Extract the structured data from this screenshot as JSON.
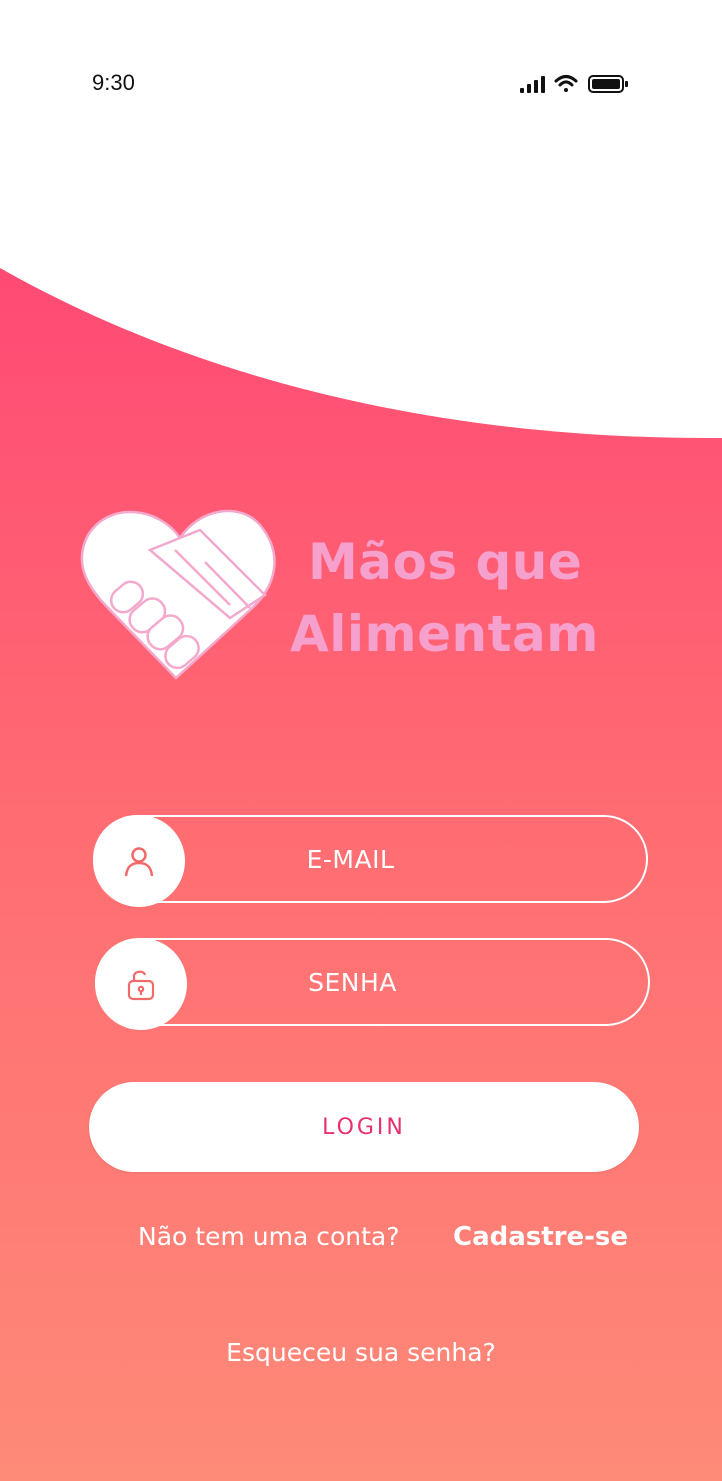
{
  "status_bar": {
    "time": "9:30",
    "icons": [
      "cellular-signal-icon",
      "wifi-icon",
      "battery-icon"
    ]
  },
  "logo": {
    "icon": "heart-handshake-icon",
    "line1": "Mãos que",
    "line2": "Alimentam"
  },
  "form": {
    "email": {
      "label": "E-MAIL",
      "icon": "user-icon"
    },
    "password": {
      "label": "SENHA",
      "icon": "lock-icon"
    },
    "login_button": "LOGIN"
  },
  "signup": {
    "question": "Não tem uma conta?",
    "link": "Cadastre-se"
  },
  "forgot_password": "Esqueceu sua senha?",
  "colors": {
    "gradient_top": "#ff4a74",
    "gradient_bottom": "#fe8a78",
    "logo_text": "#f5a0cd",
    "login_text": "#e8306e",
    "icon_accent": "#f06a6a"
  }
}
